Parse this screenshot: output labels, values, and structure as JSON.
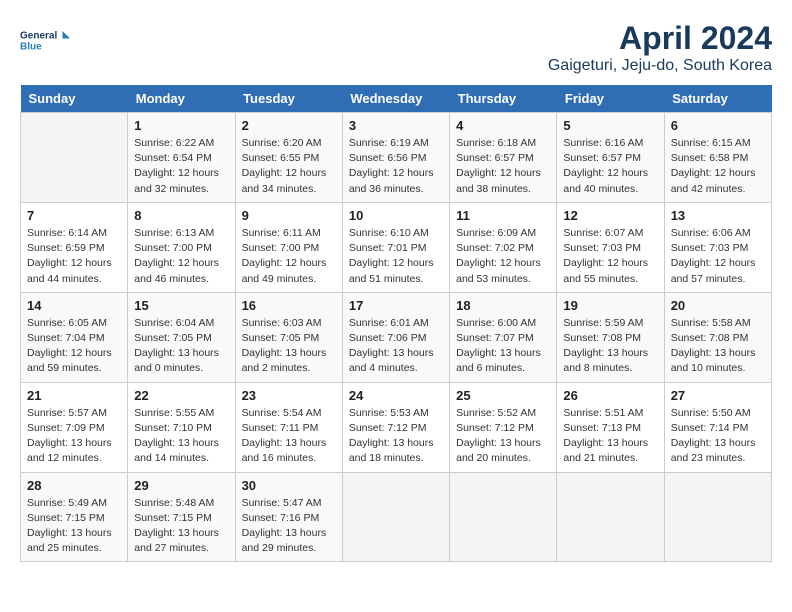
{
  "header": {
    "logo_line1": "General",
    "logo_line2": "Blue",
    "title": "April 2024",
    "subtitle": "Gaigeturi, Jeju-do, South Korea"
  },
  "weekdays": [
    "Sunday",
    "Monday",
    "Tuesday",
    "Wednesday",
    "Thursday",
    "Friday",
    "Saturday"
  ],
  "weeks": [
    [
      {
        "day": "",
        "info": ""
      },
      {
        "day": "1",
        "info": "Sunrise: 6:22 AM\nSunset: 6:54 PM\nDaylight: 12 hours\nand 32 minutes."
      },
      {
        "day": "2",
        "info": "Sunrise: 6:20 AM\nSunset: 6:55 PM\nDaylight: 12 hours\nand 34 minutes."
      },
      {
        "day": "3",
        "info": "Sunrise: 6:19 AM\nSunset: 6:56 PM\nDaylight: 12 hours\nand 36 minutes."
      },
      {
        "day": "4",
        "info": "Sunrise: 6:18 AM\nSunset: 6:57 PM\nDaylight: 12 hours\nand 38 minutes."
      },
      {
        "day": "5",
        "info": "Sunrise: 6:16 AM\nSunset: 6:57 PM\nDaylight: 12 hours\nand 40 minutes."
      },
      {
        "day": "6",
        "info": "Sunrise: 6:15 AM\nSunset: 6:58 PM\nDaylight: 12 hours\nand 42 minutes."
      }
    ],
    [
      {
        "day": "7",
        "info": "Sunrise: 6:14 AM\nSunset: 6:59 PM\nDaylight: 12 hours\nand 44 minutes."
      },
      {
        "day": "8",
        "info": "Sunrise: 6:13 AM\nSunset: 7:00 PM\nDaylight: 12 hours\nand 46 minutes."
      },
      {
        "day": "9",
        "info": "Sunrise: 6:11 AM\nSunset: 7:00 PM\nDaylight: 12 hours\nand 49 minutes."
      },
      {
        "day": "10",
        "info": "Sunrise: 6:10 AM\nSunset: 7:01 PM\nDaylight: 12 hours\nand 51 minutes."
      },
      {
        "day": "11",
        "info": "Sunrise: 6:09 AM\nSunset: 7:02 PM\nDaylight: 12 hours\nand 53 minutes."
      },
      {
        "day": "12",
        "info": "Sunrise: 6:07 AM\nSunset: 7:03 PM\nDaylight: 12 hours\nand 55 minutes."
      },
      {
        "day": "13",
        "info": "Sunrise: 6:06 AM\nSunset: 7:03 PM\nDaylight: 12 hours\nand 57 minutes."
      }
    ],
    [
      {
        "day": "14",
        "info": "Sunrise: 6:05 AM\nSunset: 7:04 PM\nDaylight: 12 hours\nand 59 minutes."
      },
      {
        "day": "15",
        "info": "Sunrise: 6:04 AM\nSunset: 7:05 PM\nDaylight: 13 hours\nand 0 minutes."
      },
      {
        "day": "16",
        "info": "Sunrise: 6:03 AM\nSunset: 7:05 PM\nDaylight: 13 hours\nand 2 minutes."
      },
      {
        "day": "17",
        "info": "Sunrise: 6:01 AM\nSunset: 7:06 PM\nDaylight: 13 hours\nand 4 minutes."
      },
      {
        "day": "18",
        "info": "Sunrise: 6:00 AM\nSunset: 7:07 PM\nDaylight: 13 hours\nand 6 minutes."
      },
      {
        "day": "19",
        "info": "Sunrise: 5:59 AM\nSunset: 7:08 PM\nDaylight: 13 hours\nand 8 minutes."
      },
      {
        "day": "20",
        "info": "Sunrise: 5:58 AM\nSunset: 7:08 PM\nDaylight: 13 hours\nand 10 minutes."
      }
    ],
    [
      {
        "day": "21",
        "info": "Sunrise: 5:57 AM\nSunset: 7:09 PM\nDaylight: 13 hours\nand 12 minutes."
      },
      {
        "day": "22",
        "info": "Sunrise: 5:55 AM\nSunset: 7:10 PM\nDaylight: 13 hours\nand 14 minutes."
      },
      {
        "day": "23",
        "info": "Sunrise: 5:54 AM\nSunset: 7:11 PM\nDaylight: 13 hours\nand 16 minutes."
      },
      {
        "day": "24",
        "info": "Sunrise: 5:53 AM\nSunset: 7:12 PM\nDaylight: 13 hours\nand 18 minutes."
      },
      {
        "day": "25",
        "info": "Sunrise: 5:52 AM\nSunset: 7:12 PM\nDaylight: 13 hours\nand 20 minutes."
      },
      {
        "day": "26",
        "info": "Sunrise: 5:51 AM\nSunset: 7:13 PM\nDaylight: 13 hours\nand 21 minutes."
      },
      {
        "day": "27",
        "info": "Sunrise: 5:50 AM\nSunset: 7:14 PM\nDaylight: 13 hours\nand 23 minutes."
      }
    ],
    [
      {
        "day": "28",
        "info": "Sunrise: 5:49 AM\nSunset: 7:15 PM\nDaylight: 13 hours\nand 25 minutes."
      },
      {
        "day": "29",
        "info": "Sunrise: 5:48 AM\nSunset: 7:15 PM\nDaylight: 13 hours\nand 27 minutes."
      },
      {
        "day": "30",
        "info": "Sunrise: 5:47 AM\nSunset: 7:16 PM\nDaylight: 13 hours\nand 29 minutes."
      },
      {
        "day": "",
        "info": ""
      },
      {
        "day": "",
        "info": ""
      },
      {
        "day": "",
        "info": ""
      },
      {
        "day": "",
        "info": ""
      }
    ]
  ]
}
